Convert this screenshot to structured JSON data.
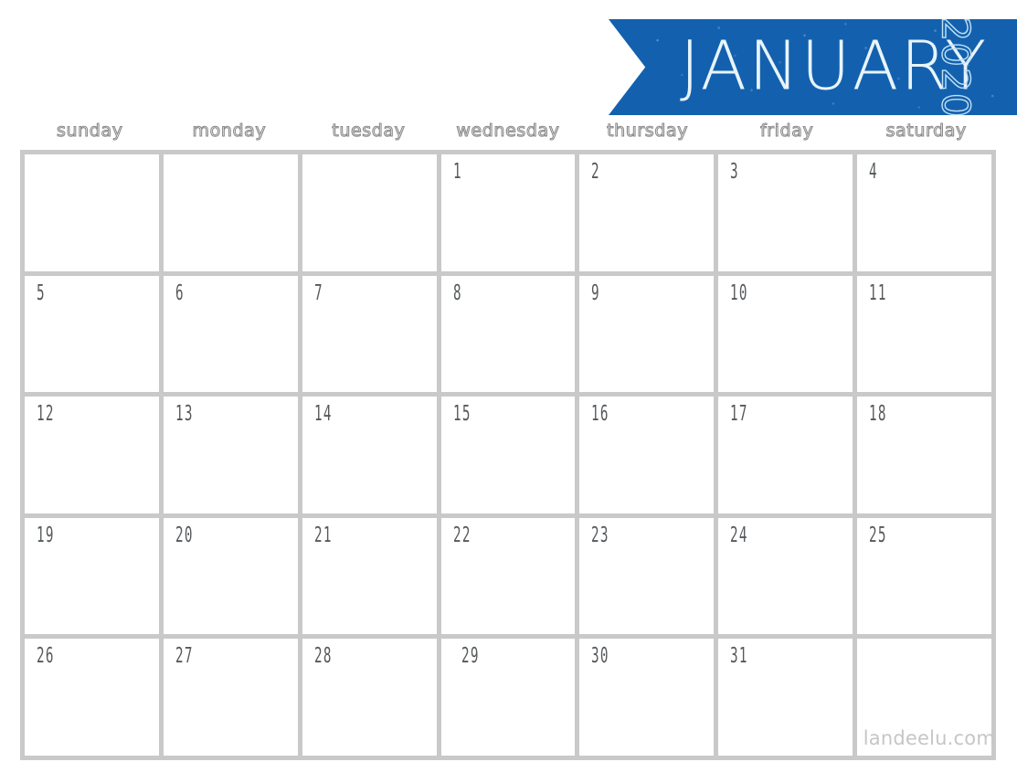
{
  "banner": {
    "month": "JANUARY",
    "year": "2020",
    "color": "#1361AE",
    "month_text_color": "#E8F4FC",
    "year_text_color": "#BFE0F5"
  },
  "weekdays": [
    {
      "label": "sunday"
    },
    {
      "label": "monday"
    },
    {
      "label": "tuesday"
    },
    {
      "label": "wednesday"
    },
    {
      "label": "thursday"
    },
    {
      "label": "friday"
    },
    {
      "label": "saturday"
    }
  ],
  "grid": {
    "line_color": "#C9C9C9",
    "cell_color": "#FFFFFF",
    "rows": 5,
    "columns": 7
  },
  "weeks": [
    [
      {
        "day": ""
      },
      {
        "day": ""
      },
      {
        "day": ""
      },
      {
        "day": "1"
      },
      {
        "day": "2"
      },
      {
        "day": "3"
      },
      {
        "day": "4"
      }
    ],
    [
      {
        "day": "5"
      },
      {
        "day": "6"
      },
      {
        "day": "7"
      },
      {
        "day": "8"
      },
      {
        "day": "9"
      },
      {
        "day": "10"
      },
      {
        "day": "11"
      }
    ],
    [
      {
        "day": "12"
      },
      {
        "day": "13"
      },
      {
        "day": "14"
      },
      {
        "day": "15"
      },
      {
        "day": "16"
      },
      {
        "day": "17"
      },
      {
        "day": "18"
      }
    ],
    [
      {
        "day": "19"
      },
      {
        "day": "20"
      },
      {
        "day": "21"
      },
      {
        "day": "22"
      },
      {
        "day": "23"
      },
      {
        "day": "24"
      },
      {
        "day": "25"
      }
    ],
    [
      {
        "day": "26"
      },
      {
        "day": "27"
      },
      {
        "day": "28"
      },
      {
        "day": "29",
        "indent": true
      },
      {
        "day": "30"
      },
      {
        "day": "31"
      },
      {
        "day": ""
      }
    ]
  ],
  "watermark": {
    "text": "landeelu.com",
    "color": "#C6C6C6"
  }
}
